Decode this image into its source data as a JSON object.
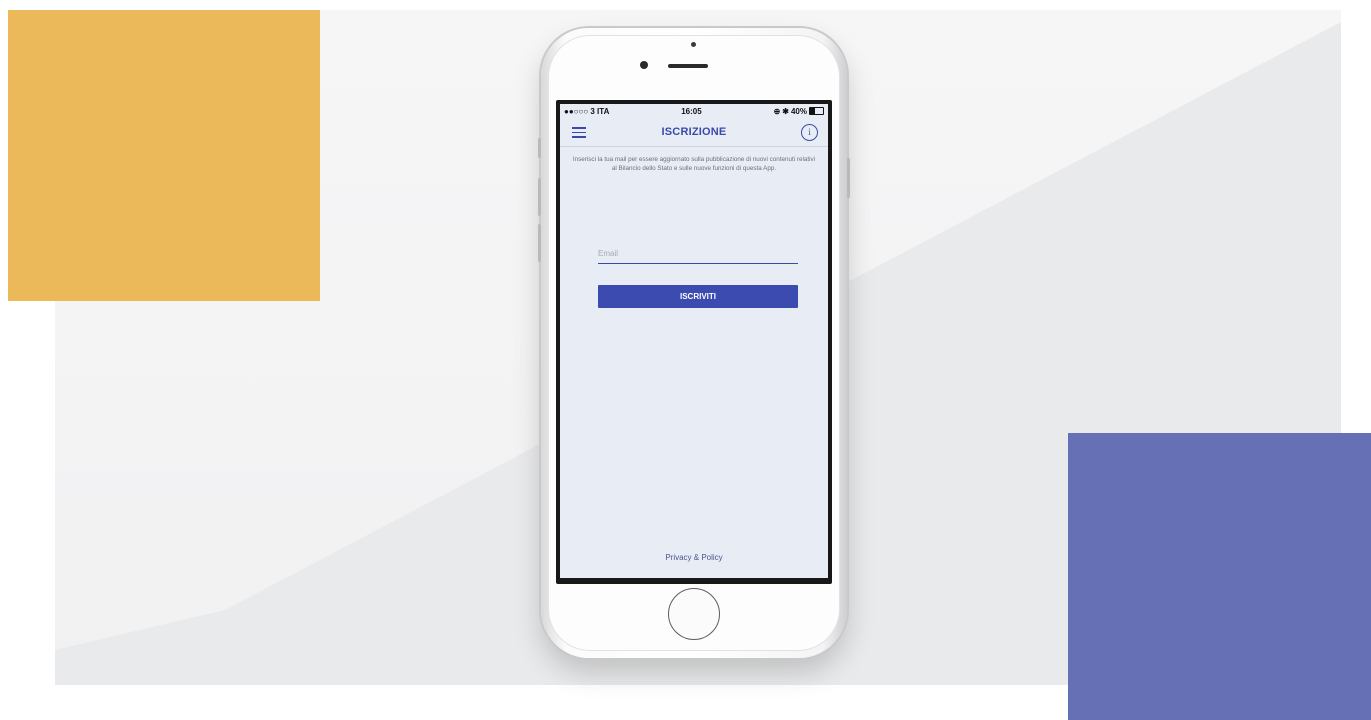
{
  "theme": {
    "accent": "#3a4aa8",
    "button_bg": "#3c4bb0",
    "yellow_block": "#ebb95a",
    "blue_block": "#6670b5",
    "screen_bg": "#e8edf5"
  },
  "statusbar": {
    "carrier": "●●○○○ 3 ITA",
    "time": "16:05",
    "battery": "40%"
  },
  "navbar": {
    "title": "ISCRIZIONE",
    "menu_icon": "hamburger-menu-icon",
    "info_icon": "info-circle-icon",
    "info_glyph": "i"
  },
  "content": {
    "intro_text": "Inserisci la tua mail per essere aggiornato sulla pubblicazione di nuovi contenuti relativi al Bilancio dello Stato e sulle nuove funzioni di questa App.",
    "email_placeholder": "Email",
    "submit_label": "ISCRIVITI",
    "privacy_link": "Privacy & Policy"
  }
}
